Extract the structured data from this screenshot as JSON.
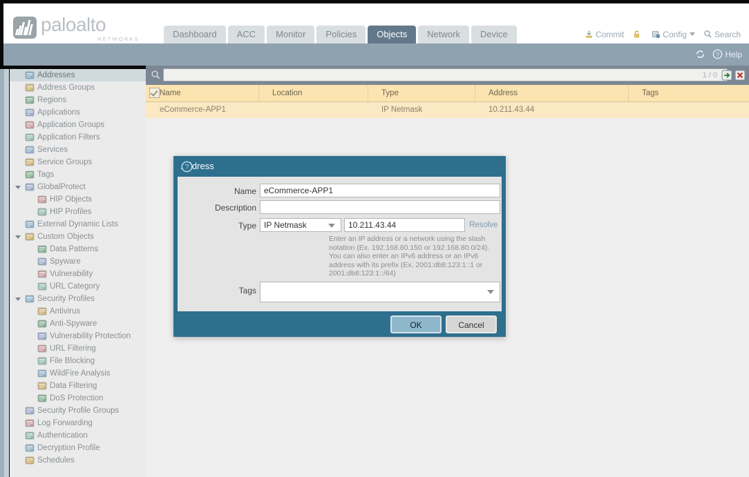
{
  "header": {
    "brand": "paloalto",
    "brand_sub": "NETWORKS",
    "tabs": [
      {
        "label": "Dashboard",
        "active": false
      },
      {
        "label": "ACC",
        "active": false
      },
      {
        "label": "Monitor",
        "active": false
      },
      {
        "label": "Policies",
        "active": false
      },
      {
        "label": "Objects",
        "active": true
      },
      {
        "label": "Network",
        "active": false
      },
      {
        "label": "Device",
        "active": false
      }
    ],
    "actions": [
      {
        "label": "Commit",
        "icon": "commit-icon"
      },
      {
        "label": "",
        "icon": "lock-icon"
      },
      {
        "label": "Config",
        "icon": "config-icon",
        "caret": true
      },
      {
        "label": "Search",
        "icon": "search-icon"
      }
    ]
  },
  "ribbon": {
    "refresh_icon": "refresh-icon",
    "help_icon": "help-icon",
    "help_label": "Help"
  },
  "sidebar": {
    "items": [
      {
        "label": "Addresses",
        "icon": "addresses-icon",
        "indent": 0,
        "selected": true,
        "twisty": false
      },
      {
        "label": "Address Groups",
        "icon": "address-groups-icon",
        "indent": 0,
        "selected": false,
        "twisty": false
      },
      {
        "label": "Regions",
        "icon": "regions-icon",
        "indent": 0,
        "selected": false,
        "twisty": false
      },
      {
        "label": "Applications",
        "icon": "applications-icon",
        "indent": 0,
        "selected": false,
        "twisty": false
      },
      {
        "label": "Application Groups",
        "icon": "application-groups-icon",
        "indent": 0,
        "selected": false,
        "twisty": false
      },
      {
        "label": "Application Filters",
        "icon": "application-filters-icon",
        "indent": 0,
        "selected": false,
        "twisty": false
      },
      {
        "label": "Services",
        "icon": "services-icon",
        "indent": 0,
        "selected": false,
        "twisty": false
      },
      {
        "label": "Service Groups",
        "icon": "service-groups-icon",
        "indent": 0,
        "selected": false,
        "twisty": false
      },
      {
        "label": "Tags",
        "icon": "tags-icon",
        "indent": 0,
        "selected": false,
        "twisty": false
      },
      {
        "label": "GlobalProtect",
        "icon": "globalprotect-icon",
        "indent": 0,
        "selected": false,
        "twisty": true
      },
      {
        "label": "HIP Objects",
        "icon": "hip-objects-icon",
        "indent": 1,
        "selected": false,
        "twisty": false
      },
      {
        "label": "HIP Profiles",
        "icon": "hip-profiles-icon",
        "indent": 1,
        "selected": false,
        "twisty": false
      },
      {
        "label": "External Dynamic Lists",
        "icon": "external-dynamic-lists-icon",
        "indent": 0,
        "selected": false,
        "twisty": false
      },
      {
        "label": "Custom Objects",
        "icon": "custom-objects-icon",
        "indent": 0,
        "selected": false,
        "twisty": true
      },
      {
        "label": "Data Patterns",
        "icon": "data-patterns-icon",
        "indent": 1,
        "selected": false,
        "twisty": false
      },
      {
        "label": "Spyware",
        "icon": "spyware-icon",
        "indent": 1,
        "selected": false,
        "twisty": false
      },
      {
        "label": "Vulnerability",
        "icon": "vulnerability-icon",
        "indent": 1,
        "selected": false,
        "twisty": false
      },
      {
        "label": "URL Category",
        "icon": "url-category-icon",
        "indent": 1,
        "selected": false,
        "twisty": false
      },
      {
        "label": "Security Profiles",
        "icon": "security-profiles-icon",
        "indent": 0,
        "selected": false,
        "twisty": true
      },
      {
        "label": "Antivirus",
        "icon": "antivirus-icon",
        "indent": 1,
        "selected": false,
        "twisty": false
      },
      {
        "label": "Anti-Spyware",
        "icon": "anti-spyware-icon",
        "indent": 1,
        "selected": false,
        "twisty": false
      },
      {
        "label": "Vulnerability Protection",
        "icon": "vulnerability-protection-icon",
        "indent": 1,
        "selected": false,
        "twisty": false
      },
      {
        "label": "URL Filtering",
        "icon": "url-filtering-icon",
        "indent": 1,
        "selected": false,
        "twisty": false
      },
      {
        "label": "File Blocking",
        "icon": "file-blocking-icon",
        "indent": 1,
        "selected": false,
        "twisty": false
      },
      {
        "label": "WildFire Analysis",
        "icon": "wildfire-analysis-icon",
        "indent": 1,
        "selected": false,
        "twisty": false
      },
      {
        "label": "Data Filtering",
        "icon": "data-filtering-icon",
        "indent": 1,
        "selected": false,
        "twisty": false
      },
      {
        "label": "DoS Protection",
        "icon": "dos-protection-icon",
        "indent": 1,
        "selected": false,
        "twisty": false
      },
      {
        "label": "Security Profile Groups",
        "icon": "security-profile-groups-icon",
        "indent": 0,
        "selected": false,
        "twisty": false
      },
      {
        "label": "Log Forwarding",
        "icon": "log-forwarding-icon",
        "indent": 0,
        "selected": false,
        "twisty": false
      },
      {
        "label": "Authentication",
        "icon": "authentication-icon",
        "indent": 0,
        "selected": false,
        "twisty": false
      },
      {
        "label": "Decryption Profile",
        "icon": "decryption-profile-icon",
        "indent": 0,
        "selected": false,
        "twisty": false
      },
      {
        "label": "Schedules",
        "icon": "schedules-icon",
        "indent": 0,
        "selected": false,
        "twisty": false
      }
    ]
  },
  "filterbar": {
    "search_icon": "search-icon",
    "value": "",
    "placeholder": "",
    "count": "1 / 0",
    "apply_icon": "apply-filter-icon",
    "clear_icon": "clear-filter-icon"
  },
  "table": {
    "columns": [
      "Name",
      "Location",
      "Type",
      "Address",
      "Tags"
    ],
    "rows": [
      {
        "checked": true,
        "name": "eCommerce-APP1",
        "location": "",
        "type": "IP Netmask",
        "address": "10.211.43.44",
        "tags": ""
      }
    ]
  },
  "dialog": {
    "title": "Address",
    "help_icon": "help-icon",
    "fields": {
      "name_label": "Name",
      "name_value": "eCommerce-APP1",
      "description_label": "Description",
      "description_value": "",
      "type_label": "Type",
      "type_value": "IP Netmask",
      "address_value": "10.211.43.44",
      "resolve_label": "Resolve",
      "tags_label": "Tags",
      "tags_value": ""
    },
    "hint": "Enter an IP address or a network using the slash notation (Ex. 192.168.80.150 or 192.168.80.0/24). You can also enter an IPv6 address or an IPv6 address with its prefix (Ex. 2001:db8:123:1::1 or 2001:db8:123:1::/64)",
    "ok_label": "OK",
    "cancel_label": "Cancel"
  },
  "colors": {
    "accent_dark": "#2e6f8e",
    "tab_active": "#63798a",
    "ribbon": "#8fa2b0",
    "table_header": "#fbe4b0",
    "table_row": "#fbe9c4"
  }
}
